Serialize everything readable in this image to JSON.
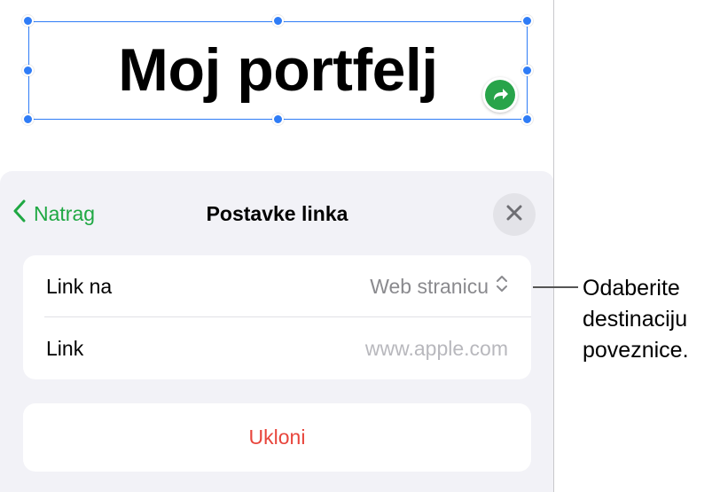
{
  "canvas": {
    "title_text": "Moj portfelj"
  },
  "sheet": {
    "back_label": "Natrag",
    "title": "Postavke linka",
    "rows": [
      {
        "label": "Link na",
        "value": "Web stranicu"
      },
      {
        "label": "Link",
        "placeholder": "www.apple.com"
      }
    ],
    "remove_label": "Ukloni"
  },
  "callout": {
    "text": "Odaberite\ndestinaciju\npoveznice."
  },
  "colors": {
    "accent_green": "#1fa843",
    "selection_blue": "#2f7cf6",
    "destructive_red": "#e8453c",
    "sheet_bg": "#f2f2f7",
    "placeholder_gray": "#b8b8bd",
    "value_gray": "#8a8a8e"
  },
  "icons": {
    "back": "chevron-left-icon",
    "close": "close-icon",
    "link_badge": "link-arrow-icon",
    "value_selector": "chevron-updown-icon"
  }
}
